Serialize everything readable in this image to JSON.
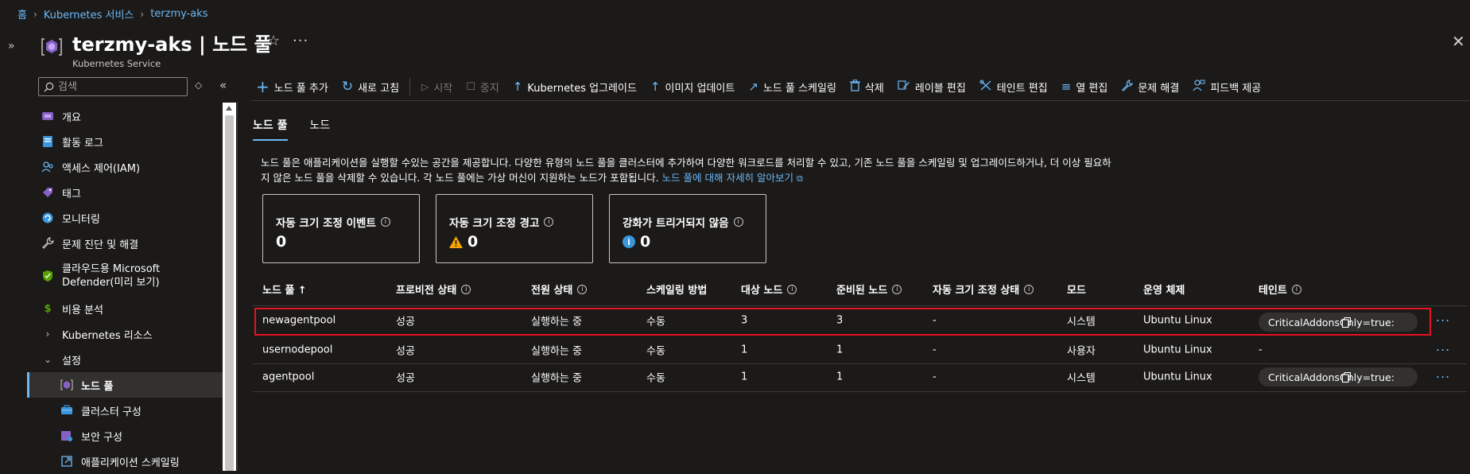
{
  "breadcrumb": [
    "홈",
    "Kubernetes 서비스",
    "terzmy-aks"
  ],
  "header": {
    "title": "terzmy-aks | 노드 풀",
    "subtitle": "Kubernetes Service"
  },
  "sidebar": {
    "search_placeholder": "검색",
    "items": [
      {
        "label": "개요",
        "icon": "overview-icon",
        "color": "#8661c5"
      },
      {
        "label": "활동 로그",
        "icon": "activity-log-icon",
        "color": "#3a96dd"
      },
      {
        "label": "액세스 제어(IAM)",
        "icon": "access-control-icon",
        "color": "#6cb8f6"
      },
      {
        "label": "태그",
        "icon": "tag-icon",
        "color": "#8661c5"
      },
      {
        "label": "모니터링",
        "icon": "monitoring-icon",
        "color": "#3a96dd"
      },
      {
        "label": "문제 진단 및 해결",
        "icon": "wrench-icon",
        "color": "#c8c6c4"
      },
      {
        "label": "클라우드용 Microsoft Defender(미리 보기)",
        "icon": "defender-shield-icon",
        "color": "#57a300"
      },
      {
        "label": "비용 분석",
        "icon": "cost-analysis-icon",
        "color": "#57a300"
      },
      {
        "label": "Kubernetes 리소스",
        "icon": "chevron-right-icon"
      },
      {
        "label": "설정",
        "icon": "chevron-down-icon"
      },
      {
        "label": "노드 풀",
        "icon": "node-pool-icon",
        "color": "#8661c5"
      },
      {
        "label": "클러스터 구성",
        "icon": "cluster-config-icon",
        "color": "#3a96dd"
      },
      {
        "label": "보안 구성",
        "icon": "security-config-icon",
        "color": "#8661c5"
      },
      {
        "label": "애플리케이션 스케일링",
        "icon": "app-scaling-icon",
        "color": "#6cb8f6"
      }
    ]
  },
  "toolbar": {
    "add_node_pool": "노드 풀 추가",
    "refresh": "새로 고침",
    "start": "시작",
    "stop": "중지",
    "k8s_upgrade": "Kubernetes 업그레이드",
    "image_update": "이미지 업데이트",
    "scale": "노드 풀 스케일링",
    "delete": "삭제",
    "edit_labels": "레이블 편집",
    "edit_taints": "테인트 편집",
    "edit_columns": "열 편집",
    "troubleshoot": "문제 해결",
    "feedback": "피드백 제공"
  },
  "tabs": [
    "노드 풀",
    "노드"
  ],
  "description": {
    "text": "노드 풀은 애플리케이션을 실행할 수있는 공간을 제공합니다. 다양한 유형의 노드 풀을 클러스터에 추가하여 다양한 워크로드를 처리할 수 있고, 기존 노드 풀을 스케일링 및 업그레이드하거나, 더 이상 필요하지 않은 노드 풀을 삭제할 수 있습니다. 각 노드 풀에는 가상 머신이 지원하는 노드가 포함됩니다.",
    "link": "노드 풀에 대해 자세히 알아보기"
  },
  "cards": [
    {
      "title": "자동 크기 조정 이벤트",
      "value": "0"
    },
    {
      "title": "자동 크기 조정 경고",
      "value": "0"
    },
    {
      "title": "강화가 트리거되지 않음",
      "value": "0"
    }
  ],
  "table": {
    "headers": [
      "노드 풀 ↑",
      "프로비전 상태",
      "전원 상태",
      "스케일링 방법",
      "대상 노드",
      "준비된 노드",
      "자동 크기 조정 상태",
      "모드",
      "운영 체제",
      "테인트"
    ],
    "rows": [
      {
        "name": "newagentpool",
        "provisioning": "성공",
        "power": "실행하는 중",
        "scaling": "수동",
        "target": "3",
        "ready": "3",
        "autoscale": "-",
        "mode": "시스템",
        "os": "Ubuntu Linux",
        "taint": "CriticalAddonsOnly=true:NoSchedule"
      },
      {
        "name": "usernodepool",
        "provisioning": "성공",
        "power": "실행하는 중",
        "scaling": "수동",
        "target": "1",
        "ready": "1",
        "autoscale": "-",
        "mode": "사용자",
        "os": "Ubuntu Linux",
        "taint": "-"
      },
      {
        "name": "agentpool",
        "provisioning": "성공",
        "power": "실행하는 중",
        "scaling": "수동",
        "target": "1",
        "ready": "1",
        "autoscale": "-",
        "mode": "시스템",
        "os": "Ubuntu Linux",
        "taint": "CriticalAddonsOnly=true:NoSchedule"
      }
    ]
  },
  "colors": {
    "accent": "#6cb8f6",
    "highlight": "#e81123",
    "warning": "#f7a600",
    "info": "#3a96dd"
  }
}
